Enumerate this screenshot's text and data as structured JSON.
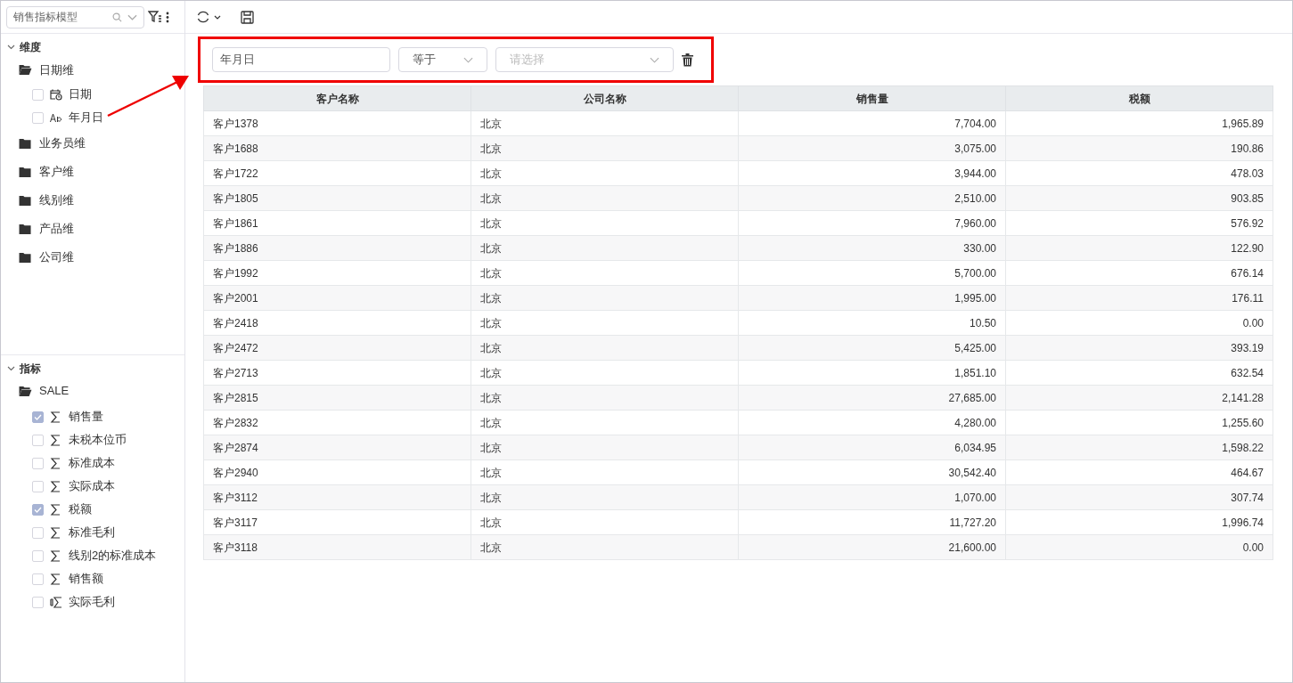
{
  "sidebar": {
    "model_select": {
      "value": "销售指标模型"
    },
    "sections": [
      {
        "title": "维度",
        "expanded": true,
        "folders": [
          {
            "label": "日期维",
            "expanded": true,
            "children": [
              {
                "label": "日期",
                "kind": "date",
                "checked": false
              },
              {
                "label": "年月日",
                "kind": "text",
                "checked": false
              }
            ]
          },
          {
            "label": "业务员维",
            "expanded": false
          },
          {
            "label": "客户维",
            "expanded": false
          },
          {
            "label": "线别维",
            "expanded": false
          },
          {
            "label": "产品维",
            "expanded": false
          },
          {
            "label": "公司维",
            "expanded": false
          }
        ]
      },
      {
        "title": "指标",
        "expanded": true,
        "folders": [
          {
            "label": "SALE",
            "expanded": true,
            "children": [
              {
                "label": "销售量",
                "kind": "measure",
                "checked": true
              },
              {
                "label": "未税本位币",
                "kind": "measure",
                "checked": false
              },
              {
                "label": "标准成本",
                "kind": "measure",
                "checked": false
              },
              {
                "label": "实际成本",
                "kind": "measure",
                "checked": false
              },
              {
                "label": "税额",
                "kind": "measure",
                "checked": true
              },
              {
                "label": "标准毛利",
                "kind": "measure",
                "checked": false
              },
              {
                "label": "线别2的标准成本",
                "kind": "measure",
                "checked": false
              },
              {
                "label": "销售额",
                "kind": "measure",
                "checked": false
              },
              {
                "label": "实际毛利",
                "kind": "calculated",
                "checked": false
              }
            ]
          }
        ]
      }
    ]
  },
  "filter": {
    "field": "年月日",
    "operator": "等于",
    "value_placeholder": "请选择"
  },
  "table": {
    "columns": [
      {
        "label": "客户名称",
        "numeric": false
      },
      {
        "label": "公司名称",
        "numeric": false
      },
      {
        "label": "销售量",
        "numeric": true
      },
      {
        "label": "税额",
        "numeric": true
      }
    ],
    "rows": [
      [
        "客户1378",
        "北京",
        "7,704.00",
        "1,965.89"
      ],
      [
        "客户1688",
        "北京",
        "3,075.00",
        "190.86"
      ],
      [
        "客户1722",
        "北京",
        "3,944.00",
        "478.03"
      ],
      [
        "客户1805",
        "北京",
        "2,510.00",
        "903.85"
      ],
      [
        "客户1861",
        "北京",
        "7,960.00",
        "576.92"
      ],
      [
        "客户1886",
        "北京",
        "330.00",
        "122.90"
      ],
      [
        "客户1992",
        "北京",
        "5,700.00",
        "676.14"
      ],
      [
        "客户2001",
        "北京",
        "1,995.00",
        "176.11"
      ],
      [
        "客户2418",
        "北京",
        "10.50",
        "0.00"
      ],
      [
        "客户2472",
        "北京",
        "5,425.00",
        "393.19"
      ],
      [
        "客户2713",
        "北京",
        "1,851.10",
        "632.54"
      ],
      [
        "客户2815",
        "北京",
        "27,685.00",
        "2,141.28"
      ],
      [
        "客户2832",
        "北京",
        "4,280.00",
        "1,255.60"
      ],
      [
        "客户2874",
        "北京",
        "6,034.95",
        "1,598.22"
      ],
      [
        "客户2940",
        "北京",
        "30,542.40",
        "464.67"
      ],
      [
        "客户3112",
        "北京",
        "1,070.00",
        "307.74"
      ],
      [
        "客户3117",
        "北京",
        "11,727.20",
        "1,996.74"
      ],
      [
        "客户3118",
        "北京",
        "21,600.00",
        "0.00"
      ]
    ]
  }
}
